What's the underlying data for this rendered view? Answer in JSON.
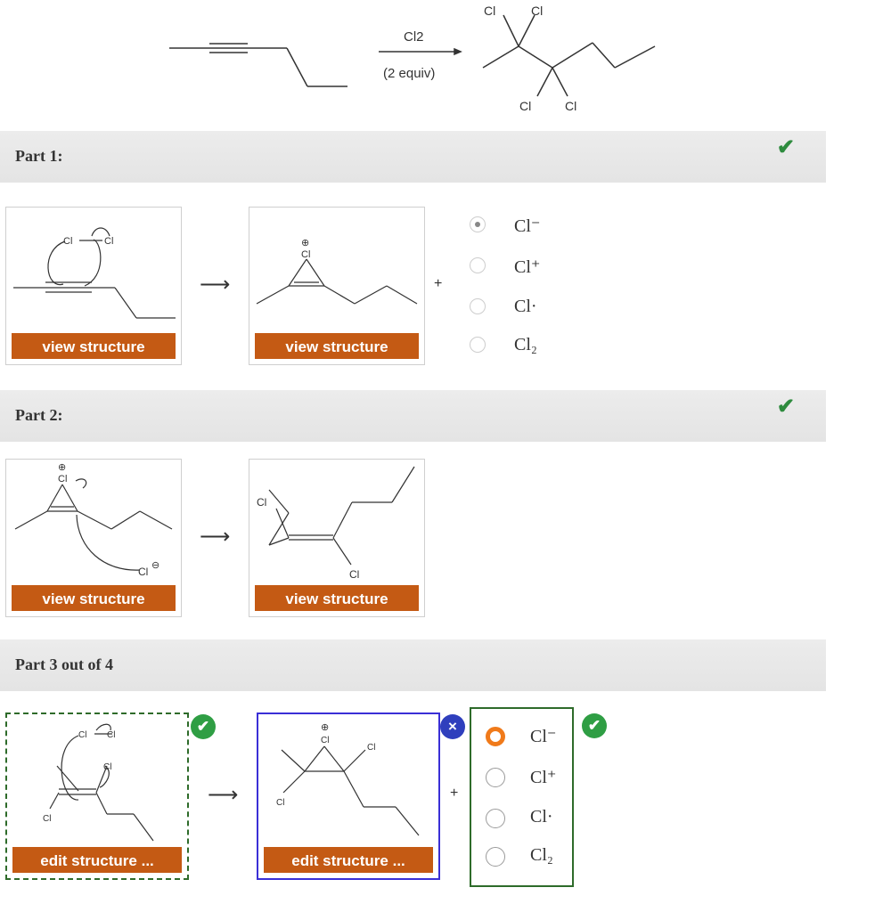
{
  "reaction": {
    "reagent": "Cl2",
    "conditions": "(2 equiv)",
    "product_atoms": [
      "Cl",
      "Cl",
      "Cl",
      "Cl"
    ]
  },
  "parts": [
    {
      "title": "Part 1:",
      "status_icon": "check-icon"
    },
    {
      "title": "Part 2:",
      "status_icon": "check-icon"
    },
    {
      "title": "Part 3 out of 4"
    }
  ],
  "buttons": {
    "view": "view structure",
    "edit": "edit structure ..."
  },
  "options": [
    {
      "label": "Cl⁻"
    },
    {
      "label": "Cl⁺"
    },
    {
      "label": "Cl·"
    },
    {
      "label": "Cl₂"
    }
  ],
  "part1_selected": 0,
  "part3_selected": 0,
  "symbols": {
    "arrow": "⟶",
    "plus": "+",
    "check": "✔",
    "close": "×"
  },
  "atoms": {
    "cl": "Cl",
    "plus_charge": "⊕",
    "minus_charge": "⊖"
  },
  "colors": {
    "orange": "#c45a14",
    "green": "#2e6b2a",
    "blue": "#3a2fd6",
    "check_green": "#2e8b3e"
  }
}
